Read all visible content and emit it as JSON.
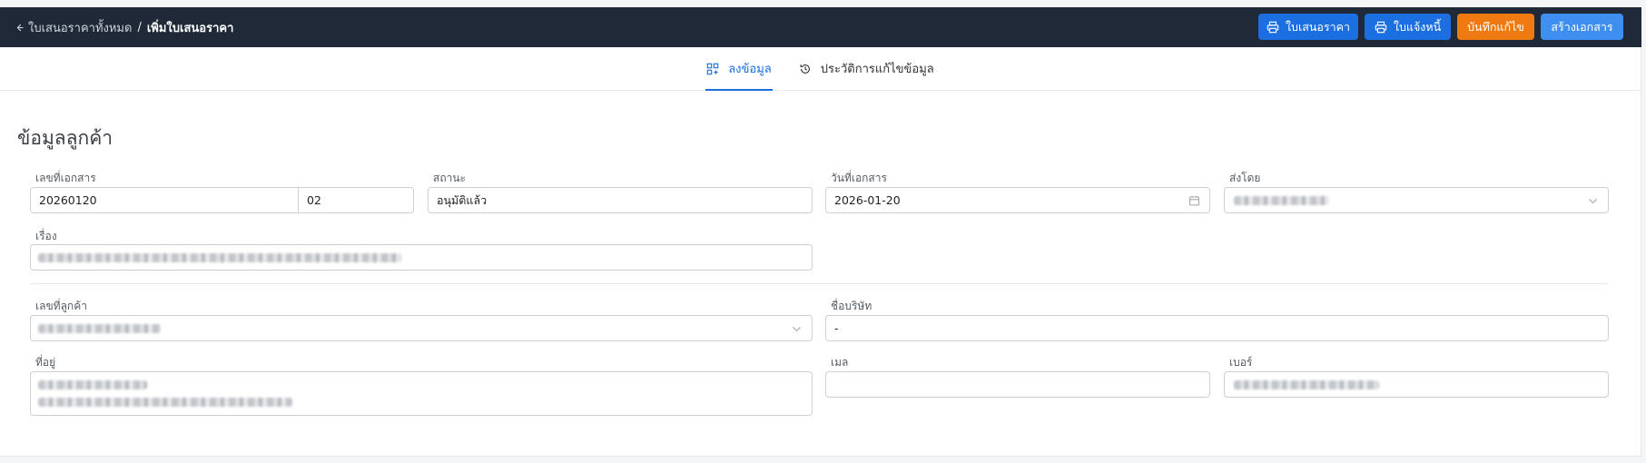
{
  "header": {
    "back_label": "ใบเสนอราคาทั้งหมด",
    "separator": "/",
    "current_page": "เพิ่มใบเสนอราคา",
    "actions": {
      "quotation_print": "ใบเสนอราคา",
      "invoice_print": "ใบแจ้งหนี้",
      "save_edit": "บันทึกแก้ไข",
      "create_document": "สร้างเอกสาร"
    }
  },
  "tabs": [
    {
      "label": "ลงข้อมูล",
      "active": true,
      "icon": "layout-grid-icon"
    },
    {
      "label": "ประวัติการแก้ไขข้อมูล",
      "active": false,
      "icon": "history-icon"
    }
  ],
  "section": {
    "title": "ข้อมูลลูกค้า"
  },
  "form": {
    "document_number": {
      "label": "เลขที่เอกสาร",
      "value": "20260120",
      "suffix": "02"
    },
    "status": {
      "label": "สถานะ",
      "value": "อนุมัติแล้ว"
    },
    "document_date": {
      "label": "วันที่เอกสาร",
      "value": "2026-01-20"
    },
    "sent_by": {
      "label": "ส่งโดย"
    },
    "subject": {
      "label": "เรื่อง"
    },
    "customer_number": {
      "label": "เลขที่ลูกค้า"
    },
    "company_name": {
      "label": "ชื่อบริษัท",
      "value": "-"
    },
    "address": {
      "label": "ที่อยู่"
    },
    "email": {
      "label": "เมล",
      "value": ""
    },
    "phone": {
      "label": "เบอร์"
    }
  },
  "colors": {
    "topbar": "#1f2937",
    "primary": "#1b6fe0",
    "accent_orange": "#f07a12",
    "secondary_blue": "#3f8ff0"
  }
}
